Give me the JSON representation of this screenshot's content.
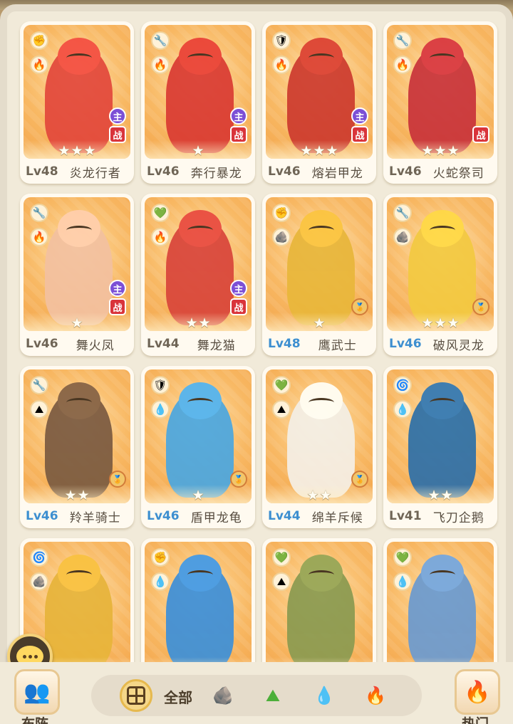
{
  "cards": [
    {
      "level": "Lv48",
      "name": "炎龙行者",
      "stars": 3,
      "lv_color": "gray",
      "type_icon": "fist-icon",
      "element_icon": "fire-icon",
      "tags": [
        "主",
        "战"
      ],
      "monster_color": "#e2473b"
    },
    {
      "level": "Lv46",
      "name": "奔行暴龙",
      "stars": 1,
      "lv_color": "gray",
      "type_icon": "wrench-icon",
      "element_icon": "fire-icon",
      "tags": [
        "主",
        "战"
      ],
      "monster_color": "#d93a32"
    },
    {
      "level": "Lv46",
      "name": "熔岩甲龙",
      "stars": 3,
      "lv_color": "gray",
      "type_icon": "shield-icon",
      "element_icon": "fire-icon",
      "tags": [
        "主",
        "战"
      ],
      "monster_color": "#cc3a2e"
    },
    {
      "level": "Lv46",
      "name": "火蛇祭司",
      "stars": 3,
      "lv_color": "gray",
      "type_icon": "wrench-icon",
      "element_icon": "fire-icon",
      "tags": [
        "战"
      ],
      "monster_color": "#c8323a"
    },
    {
      "level": "Lv46",
      "name": "舞火凤",
      "stars": 1,
      "lv_color": "gray",
      "type_icon": "wrench-icon",
      "element_icon": "fire-icon",
      "tags": [
        "主",
        "战"
      ],
      "monster_color": "#f2c0a0"
    },
    {
      "level": "Lv44",
      "name": "舞龙猫",
      "stars": 2,
      "lv_color": "gray",
      "type_icon": "heart-icon",
      "element_icon": "fire-icon",
      "tags": [
        "主",
        "战"
      ],
      "monster_color": "#d8443a"
    },
    {
      "level": "Lv48",
      "name": "鹰武士",
      "stars": 1,
      "lv_color": "blue",
      "type_icon": "fist-icon",
      "element_icon": "rock-icon",
      "tags": [
        "medal"
      ],
      "monster_color": "#e8b63a"
    },
    {
      "level": "Lv46",
      "name": "破风灵龙",
      "stars": 3,
      "lv_color": "blue",
      "type_icon": "wrench-icon",
      "element_icon": "rock-icon",
      "tags": [
        "medal"
      ],
      "monster_color": "#f2c940"
    },
    {
      "level": "Lv46",
      "name": "羚羊骑士",
      "stars": 2,
      "lv_color": "blue",
      "type_icon": "wrench-icon",
      "element_icon": "mountain-icon",
      "tags": [
        "medal"
      ],
      "monster_color": "#7a5a40"
    },
    {
      "level": "Lv46",
      "name": "盾甲龙龟",
      "stars": 1,
      "lv_color": "blue",
      "type_icon": "shield-icon",
      "element_icon": "water-icon",
      "tags": [
        "medal"
      ],
      "monster_color": "#4aa6e0"
    },
    {
      "level": "Lv44",
      "name": "绵羊斥候",
      "stars": 2,
      "lv_color": "blue",
      "type_icon": "heart-icon",
      "element_icon": "mountain-icon",
      "tags": [
        "medal"
      ],
      "monster_color": "#f4efe6"
    },
    {
      "level": "Lv41",
      "name": "飞刀企鹅",
      "stars": 2,
      "lv_color": "gray",
      "type_icon": "swirl-icon",
      "element_icon": "water-icon",
      "tags": [],
      "monster_color": "#2c6fa8"
    },
    {
      "level": "",
      "name": "",
      "stars": 0,
      "lv_color": "gray",
      "type_icon": "swirl-icon",
      "element_icon": "rock-icon",
      "tags": [],
      "monster_color": "#e7b43a"
    },
    {
      "level": "",
      "name": "",
      "stars": 0,
      "lv_color": "gray",
      "type_icon": "fist-icon",
      "element_icon": "water-icon",
      "tags": [],
      "monster_color": "#3c8fd8"
    },
    {
      "level": "",
      "name": "",
      "stars": 0,
      "lv_color": "gray",
      "type_icon": "heart-icon",
      "element_icon": "mountain-icon",
      "tags": [],
      "monster_color": "#8a9a50"
    },
    {
      "level": "",
      "name": "",
      "stars": 0,
      "lv_color": "gray",
      "type_icon": "heart-icon",
      "element_icon": "water-icon",
      "tags": [],
      "monster_color": "#6a9ad0"
    }
  ],
  "bottom": {
    "left_button_label": "布阵",
    "right_button_label": "热门",
    "filter_all_label": "全部",
    "filters": [
      "rock-icon",
      "mountain-icon",
      "water-icon",
      "fire-icon"
    ]
  },
  "icons": {
    "fist-icon": "✊",
    "wrench-icon": "🔧",
    "shield-icon": "🛡",
    "heart-icon": "💚",
    "swirl-icon": "🌀",
    "fire-icon": "🔥",
    "water-icon": "💧",
    "mountain-icon": "⛰",
    "rock-icon": "🪨"
  },
  "colors": {
    "lv_blue": "#3d8fd0",
    "lv_gray": "#6f6556",
    "tag_main": "#7c4fd6",
    "tag_battle": "#d9343b"
  }
}
